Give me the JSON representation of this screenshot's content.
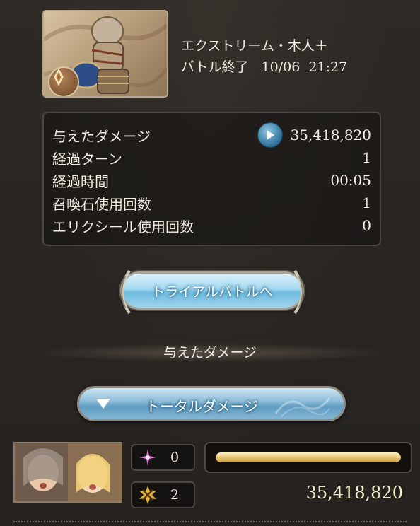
{
  "quest": {
    "name": "エクストリーム・木人＋",
    "status": "バトル終了",
    "date": "10/06",
    "time": "21:27",
    "image_icon": "dummy-target-icon",
    "element_icon": "earth-element-icon"
  },
  "stats": [
    {
      "label": "与えたダメージ",
      "value": "35,418,820",
      "has_play": true
    },
    {
      "label": "経過ターン",
      "value": "1"
    },
    {
      "label": "経過時間",
      "value": "00:05"
    },
    {
      "label": "召喚石使用回数",
      "value": "1"
    },
    {
      "label": "エリクシール使用回数",
      "value": "0"
    }
  ],
  "trial_button": {
    "label": "トライアルバトルへ"
  },
  "section": {
    "title": "与えたダメージ"
  },
  "total_button": {
    "label": "トータルダメージ",
    "icon": "triangle-down-icon"
  },
  "party": [
    {
      "portrait_icon": "character-portrait",
      "stat1": {
        "icon": "sparkle-icon",
        "value": "0"
      },
      "stat2": {
        "icon": "crossed-swords-icon",
        "value": "2"
      },
      "gauge_fraction": 1.0,
      "damage": "35,418,820"
    }
  ],
  "colors": {
    "background": "#2a2622",
    "button_blue": "#8fc7e6",
    "gauge_gold": "#e8c474"
  }
}
